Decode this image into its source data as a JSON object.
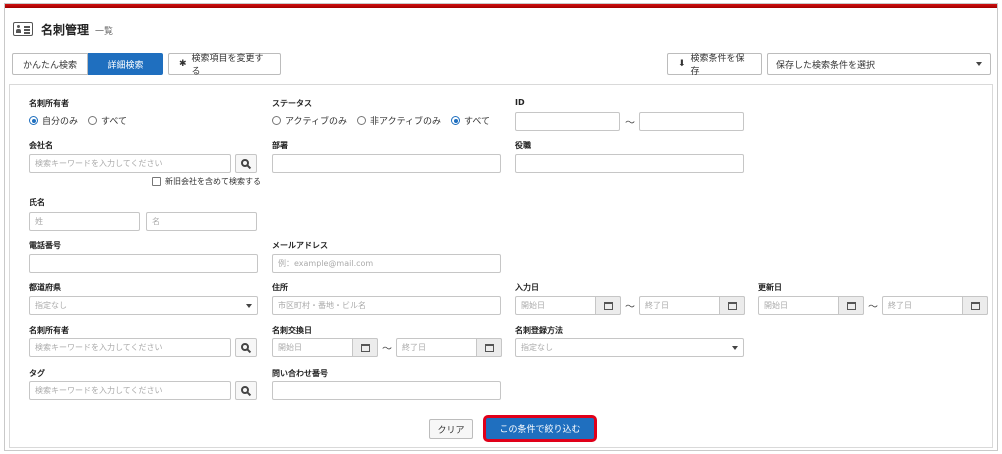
{
  "header": {
    "title": "名刺管理",
    "subtitle": "一覧"
  },
  "toolbar": {
    "tabs": [
      {
        "label": "かんたん検索",
        "active": false
      },
      {
        "label": "詳細検索",
        "active": true
      }
    ],
    "change_fields_label": "検索項目を変更する",
    "save_condition_label": "検索条件を保存",
    "saved_condition_select": "保存した検索条件を選択"
  },
  "form": {
    "owner": {
      "label": "名刺所有者",
      "options": [
        {
          "label": "自分のみ",
          "selected": true
        },
        {
          "label": "すべて",
          "selected": false
        }
      ]
    },
    "status": {
      "label": "ステータス",
      "options": [
        {
          "label": "アクティブのみ",
          "selected": false
        },
        {
          "label": "非アクティブのみ",
          "selected": false
        },
        {
          "label": "すべて",
          "selected": true
        }
      ]
    },
    "id": {
      "label": "ID",
      "tilde": "〜"
    },
    "company": {
      "label": "会社名",
      "placeholder": "検索キーワードを入力してください",
      "include_old_label": "新旧会社を含めて検索する"
    },
    "department": {
      "label": "部署"
    },
    "position": {
      "label": "役職"
    },
    "name": {
      "label": "氏名",
      "last_placeholder": "姓",
      "first_placeholder": "名"
    },
    "phone": {
      "label": "電話番号"
    },
    "email": {
      "label": "メールアドレス",
      "placeholder": "例：example@mail.com"
    },
    "prefecture": {
      "label": "都道府県",
      "value": "指定なし"
    },
    "address": {
      "label": "住所",
      "placeholder": "市区町村・番地・ビル名"
    },
    "input_date": {
      "label": "入力日",
      "start": "開始日",
      "end": "終了日",
      "tilde": "〜"
    },
    "update_date": {
      "label": "更新日",
      "start": "開始日",
      "end": "終了日",
      "tilde": "〜"
    },
    "card_owner": {
      "label": "名刺所有者",
      "placeholder": "検索キーワードを入力してください"
    },
    "exchange_date": {
      "label": "名刺交換日",
      "start": "開始日",
      "end": "終了日",
      "tilde": "〜"
    },
    "register_method": {
      "label": "名刺登録方法",
      "value": "指定なし"
    },
    "tag": {
      "label": "タグ",
      "placeholder": "検索キーワードを入力してください"
    },
    "inquiry_no": {
      "label": "問い合わせ番号"
    }
  },
  "actions": {
    "clear_label": "クリア",
    "apply_label": "この条件で絞り込む"
  },
  "colors": {
    "accent": "#1f6fbf",
    "highlight": "#e0001a",
    "topbar": "#c00000"
  }
}
